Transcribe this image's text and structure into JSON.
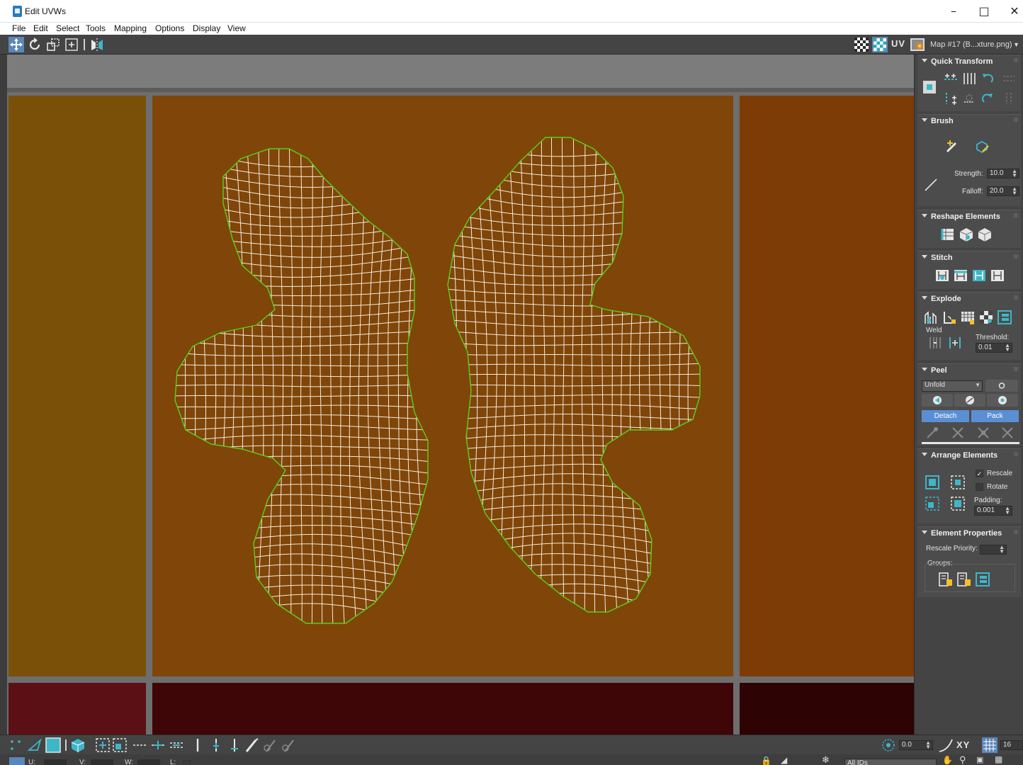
{
  "window": {
    "title": "Edit UVWs",
    "minimize_icon": "minimize-icon",
    "maximize_icon": "maximize-icon",
    "close_icon": "close-icon"
  },
  "menu": [
    "File",
    "Edit",
    "Select",
    "Tools",
    "Mapping",
    "Options",
    "Display",
    "View"
  ],
  "toolbar": {
    "tools": [
      "move-icon",
      "rotate-icon",
      "scale-icon",
      "freeform-icon",
      "mirror-icon"
    ],
    "right_icons": [
      "checker-icon",
      "checker-color-icon"
    ],
    "uv_label": "UV",
    "map_icon": "texture-map-icon",
    "map_dropdown": "Map #17 (B...xture.png)"
  },
  "viewport": {
    "tile_colors": {
      "top_left": "#7a5008",
      "top_center": "#804508",
      "top_right": "#7d3c06",
      "bottom_left": "#5a1015",
      "bottom_center": "#3f0608",
      "bottom_right": "#2e0304"
    },
    "wire_color": "#f3ede0",
    "border_color": "#55d21e"
  },
  "panel": {
    "quick_transform": {
      "title": "Quick Transform"
    },
    "brush": {
      "title": "Brush",
      "strength_label": "Strength:",
      "strength_value": "10.0",
      "falloff_label": "Falloff:",
      "falloff_value": "20.0"
    },
    "reshape": {
      "title": "Reshape Elements"
    },
    "stitch": {
      "title": "Stitch"
    },
    "explode": {
      "title": "Explode",
      "weld_label": "Weld",
      "threshold_label": "Threshold:",
      "threshold_value": "0.01"
    },
    "peel": {
      "title": "Peel",
      "mode": "Unfold",
      "detach": "Detach",
      "pack": "Pack"
    },
    "arrange": {
      "title": "Arrange Elements",
      "rescale": "Rescale",
      "rotate": "Rotate",
      "padding_label": "Padding:",
      "padding_value": "0.001"
    },
    "element_props": {
      "title": "Element Properties",
      "rescale_priority": "Rescale Priority:",
      "groups": "Groups:"
    }
  },
  "bottom": {
    "value": "0.0",
    "xy": "XY",
    "grid_value": "16",
    "u_label": "U:",
    "v_label": "V:",
    "w_label": "W:",
    "l_label": "L:",
    "ids": "All IDs"
  }
}
